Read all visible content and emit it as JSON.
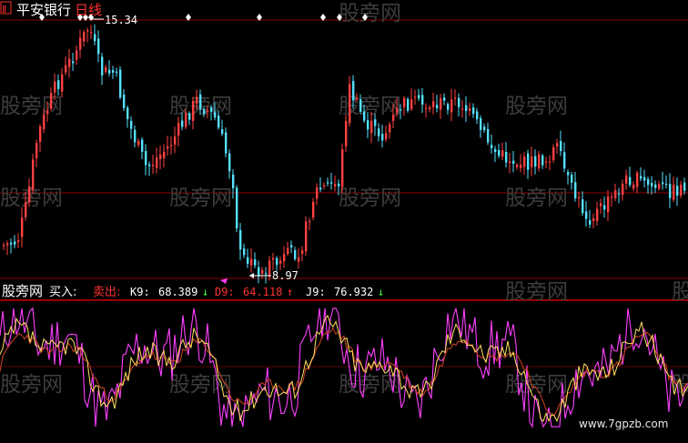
{
  "header": {
    "badge": "Ⅱ",
    "stock_name": "平安银行",
    "period": "日线",
    "high_label": "15.34",
    "low_label": "8.97"
  },
  "indicator": {
    "title": "股旁网",
    "buy_label": "买入:",
    "sell_label": "卖出:",
    "k_label": "K9:",
    "k_value": "68.389",
    "d_label": "D9:",
    "d_value": "64.118",
    "j_label": "J9:",
    "j_value": "76.932"
  },
  "watermark": {
    "text": "股旁网",
    "site": "www.7gpzb.com"
  },
  "colors": {
    "up": "#ff4040",
    "down": "#55e0ff",
    "k_line": "#ffffff",
    "d_line": "#ffe060",
    "j_line": "#ff40ff",
    "grid": "#8a0000"
  },
  "chart_data": {
    "type": "line",
    "panels": [
      "candlestick",
      "KDJ"
    ],
    "price": {
      "high": 15.34,
      "low": 8.97
    },
    "series": [
      {
        "name": "K9",
        "last": 68.389
      },
      {
        "name": "D9",
        "last": 64.118
      },
      {
        "name": "J9",
        "last": 76.932
      }
    ]
  }
}
